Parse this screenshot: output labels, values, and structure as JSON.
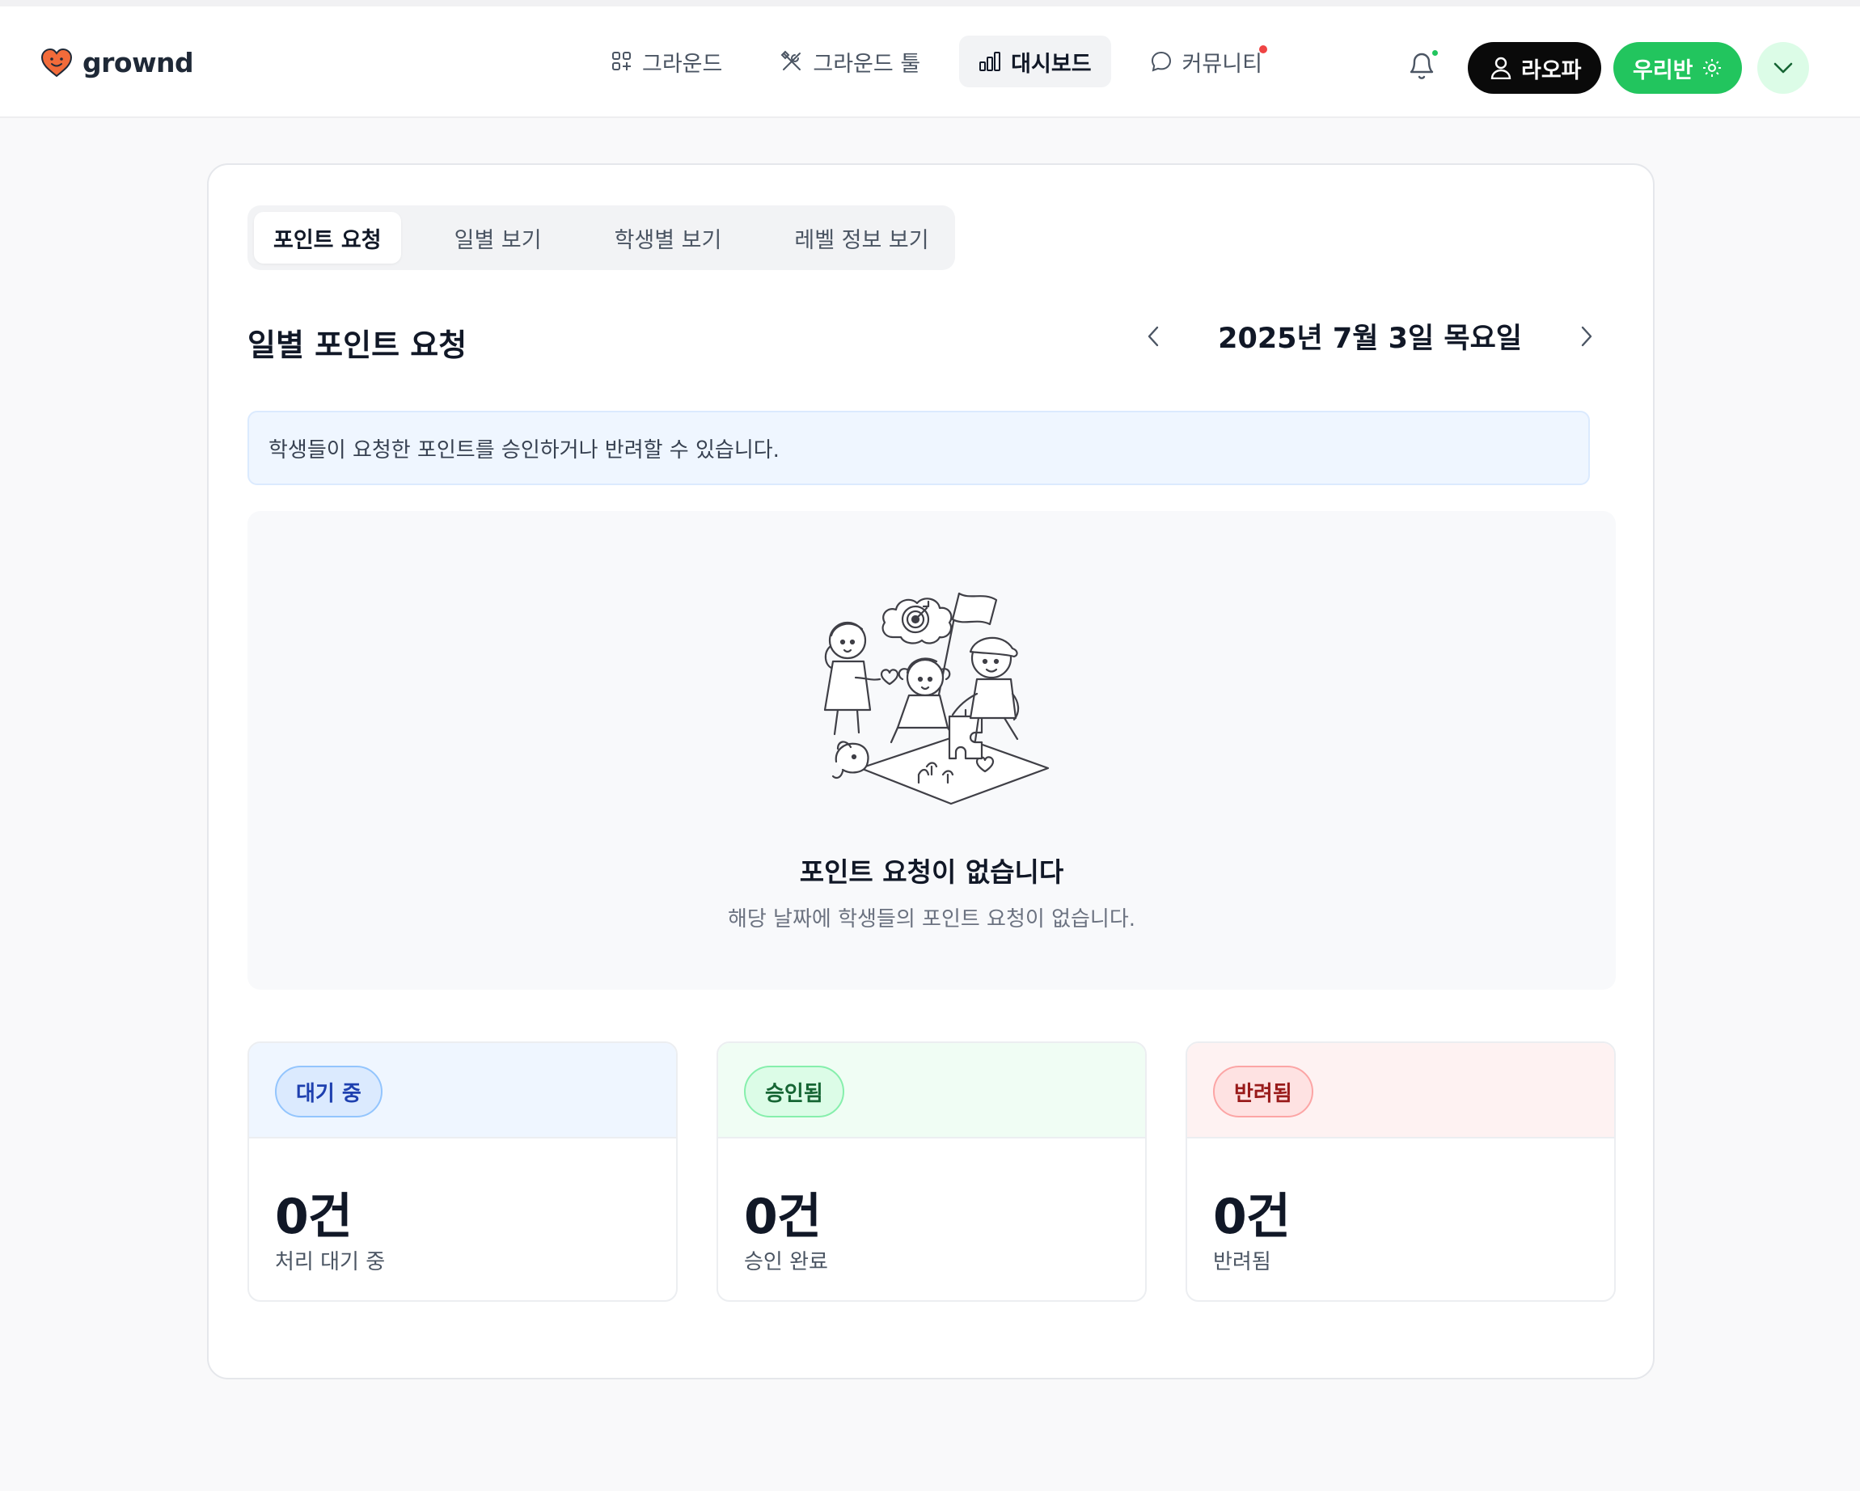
{
  "app": {
    "name": "grownd"
  },
  "nav": {
    "items": [
      {
        "label": "그라운드",
        "icon": "grid-plus-icon"
      },
      {
        "label": "그라운드 툴",
        "icon": "tools-icon"
      },
      {
        "label": "대시보드",
        "icon": "bar-chart-icon",
        "active": true
      },
      {
        "label": "커뮤니티",
        "icon": "chat-bubble-icon",
        "has_badge": true
      }
    ]
  },
  "header": {
    "user_label": "라오파",
    "class_label": "우리반"
  },
  "tabs": [
    {
      "label": "포인트 요청",
      "active": true
    },
    {
      "label": "일별 보기"
    },
    {
      "label": "학생별 보기"
    },
    {
      "label": "레벨 정보 보기"
    }
  ],
  "main": {
    "title": "일별 포인트 요청",
    "date": "2025년 7월 3일 목요일",
    "info": "학생들이 요청한 포인트를 승인하거나 반려할 수 있습니다.",
    "empty_title": "포인트 요청이 없습니다",
    "empty_subtitle": "해당 날짜에 학생들의 포인트 요청이 없습니다."
  },
  "stats": [
    {
      "badge": "대기 중",
      "count": "0건",
      "label": "처리 대기 중",
      "head_bg": "#eff6ff",
      "pill_bg": "#dbeafe",
      "pill_border": "#93c5fd",
      "pill_text": "#1e40af"
    },
    {
      "badge": "승인됨",
      "count": "0건",
      "label": "승인 완료",
      "head_bg": "#f0fdf4",
      "pill_bg": "#dcfce7",
      "pill_border": "#86efac",
      "pill_text": "#166534"
    },
    {
      "badge": "반려됨",
      "count": "0건",
      "label": "반려됨",
      "head_bg": "#fef2f2",
      "pill_bg": "#fee2e2",
      "pill_border": "#fca5a5",
      "pill_text": "#991b1b"
    }
  ],
  "colors": {
    "brand_green": "#22c55e",
    "logo_orange": "#f26b3a"
  }
}
